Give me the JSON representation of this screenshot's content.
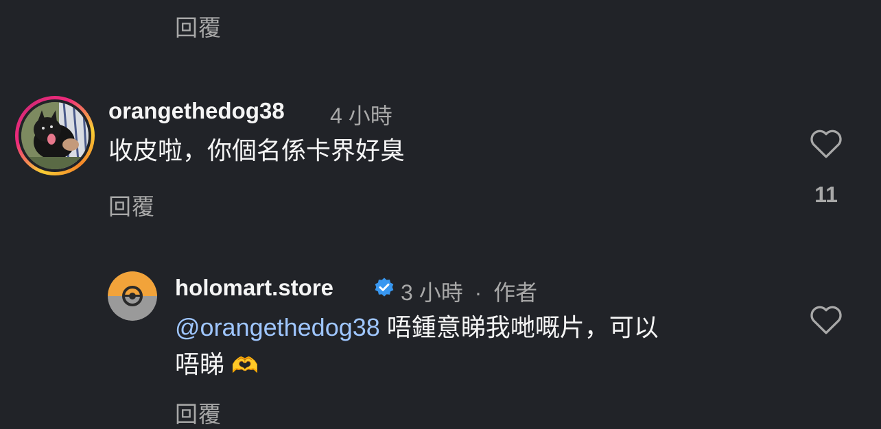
{
  "top_reply": {
    "reply_label": "回覆"
  },
  "comment": {
    "username": "orangethedog38",
    "time": "4 小時",
    "text": "收皮啦，你個名係卡界好臭",
    "reply_label": "回覆",
    "like_count": "11",
    "icons": {
      "like": "heart-outline-icon"
    }
  },
  "reply": {
    "username": "holomart.store",
    "verified_icon": "verified-badge-icon",
    "time": "3 小時",
    "separator": "·",
    "author_tag": "作者",
    "mention": "@orangethedog38",
    "text_line1": " 唔鍾意睇我哋嘅片，可以",
    "text_line2": "唔睇",
    "emoji": "🫶",
    "reply_label": "回覆",
    "icons": {
      "like": "heart-outline-icon"
    }
  },
  "colors": {
    "background": "#212328",
    "primary_text": "#f5f5f5",
    "secondary_text": "#a8a8a8",
    "mention": "#9fc6ff",
    "verified": "#3897f0"
  }
}
